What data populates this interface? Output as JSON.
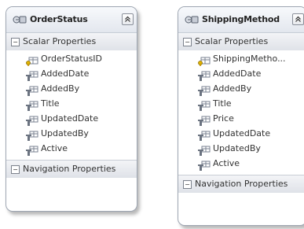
{
  "entities": [
    {
      "title": "OrderStatus",
      "scalar_label": "Scalar Properties",
      "navigation_label": "Navigation Properties",
      "properties": [
        "OrderStatusID",
        "AddedDate",
        "AddedBy",
        "Title",
        "UpdatedDate",
        "UpdatedBy",
        "Active"
      ]
    },
    {
      "title": "ShippingMethod",
      "scalar_label": "Scalar Properties",
      "navigation_label": "Navigation Properties",
      "properties": [
        "ShippingMetho...",
        "AddedDate",
        "AddedBy",
        "Title",
        "Price",
        "UpdatedDate",
        "UpdatedBy",
        "Active"
      ]
    }
  ],
  "icons": {
    "entity": "entity-icon",
    "key_property": "key-property-icon",
    "property": "property-icon",
    "collapse": "collapse-up-icon"
  },
  "colors": {
    "border": "#9ea6b2",
    "header_top": "#f7f9fc",
    "header_bottom": "#e3e7ee",
    "key_yellow": "#e2b400"
  }
}
